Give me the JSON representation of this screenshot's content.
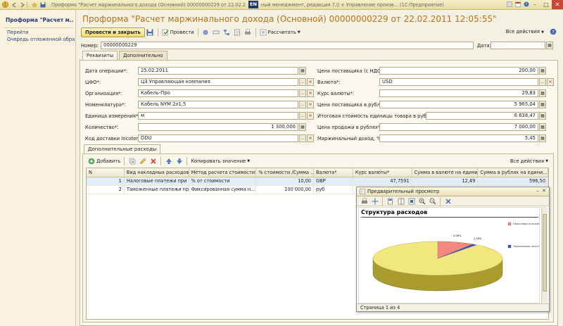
{
  "window": {
    "title": "Проформа \"Расчет маржинального дохода (Основной)  00000000229 от 22.02.2011 12:05:55\" - Корпоративный менеджмент, редакция 7.0 + Управление произ... (1С:Предприятие)",
    "title_left": "Проформа \"Расчет маржинального дохода (Основной)  00000000229 от 22.02.2011 12:05:55\" - Корпор",
    "lang": "EN",
    "title_right": "ный менеджмент, редакция 7.0 + Управление произв... (1С:Предприятие)"
  },
  "left_panel": {
    "title": "Проформа \"Расчет м...",
    "section": "Перейти",
    "link": "Очередь отложенной обра..."
  },
  "doc": {
    "title": "Проформа \"Расчет маржинального дохода (Основной)  00000000229 от 22.02.2011 12:05:55\""
  },
  "toolbar": {
    "post_close": "Провести и закрыть",
    "post": "Провести",
    "calculate": "Рассчитать",
    "all_actions": "Все действия"
  },
  "header": {
    "number_label": "Номер:",
    "number_value": "00000000229",
    "date_label": "Дата:",
    "date_value": "  .  .      :  :  "
  },
  "tabs": [
    "Реквизиты",
    "Дополнительно"
  ],
  "fields_left": [
    {
      "label": "Дата операции*:",
      "value": "25.02.2011"
    },
    {
      "label": "ЦФО*:",
      "value": "ЦЗ Управляющая компания"
    },
    {
      "label": "Организация*:",
      "value": "Кабель-Про"
    },
    {
      "label": "Номенклатура*:",
      "value": "Кабель NYM 2x1,5"
    },
    {
      "label": "Единица измерения*:",
      "value": "м"
    },
    {
      "label": "Количество*:",
      "value": "1 300,000"
    },
    {
      "label": "Код доставки Incoterm:",
      "value": "DDU"
    }
  ],
  "fields_right": [
    {
      "label": "Цена поставщика (с НДС)*:",
      "value": "200,00"
    },
    {
      "label": "Валюта*:",
      "value": "USD"
    },
    {
      "label": "Курс валюты*:",
      "value": "29,83"
    },
    {
      "label": "Цена поставщика в рублях*:",
      "value": "5 965,04"
    },
    {
      "label": "Итоговая стоимость единицы товара в рублях*:",
      "value": "6 638,47"
    },
    {
      "label": "Цена продажи в рублях*:",
      "value": "7 000,00"
    },
    {
      "label": "Маржинальный доход, %*:",
      "value": "5,45"
    }
  ],
  "extra": {
    "tab": "Дополнительные расходы",
    "add": "Добавить",
    "copy_value": "Копировать значение",
    "all_actions": "Все действия"
  },
  "table": {
    "columns": [
      "N",
      "Вид накладных расходов*",
      "Метод расчета стоимости*",
      "% стоимости /Сумма ...",
      "Валюта*",
      "Курс валюты*",
      "Сумма в валюте на едини...",
      "Сумма в рублях на едини..."
    ],
    "rows": [
      [
        "1",
        "Налоговые платежи при ...",
        "% от стоимости",
        "10,00",
        "GBP",
        "47,7591",
        "12,49",
        "596,50"
      ],
      [
        "2",
        "Таможенные платежи пр...",
        "Фиксированная сумма н...",
        "100 000,00",
        "руб",
        "",
        "",
        ""
      ]
    ]
  },
  "preview": {
    "title": "Предварительный просмотр",
    "status": "Страница 1 из 4"
  },
  "chart_data": {
    "type": "pie",
    "title": "Структура расходов",
    "categories": [
      "Налоговые платежи при импорте",
      "Таможенные платежи при импорте"
    ],
    "values": [
      9.06,
      1.16
    ],
    "labels": [
      "9,06%",
      "1,16%"
    ],
    "colors": [
      "#f4877e",
      "#3a4fc9"
    ],
    "legend_position": "right"
  },
  "colors": {
    "accent": "#b87313",
    "link": "#2b3e79",
    "pie_base": "#f2e77f"
  }
}
